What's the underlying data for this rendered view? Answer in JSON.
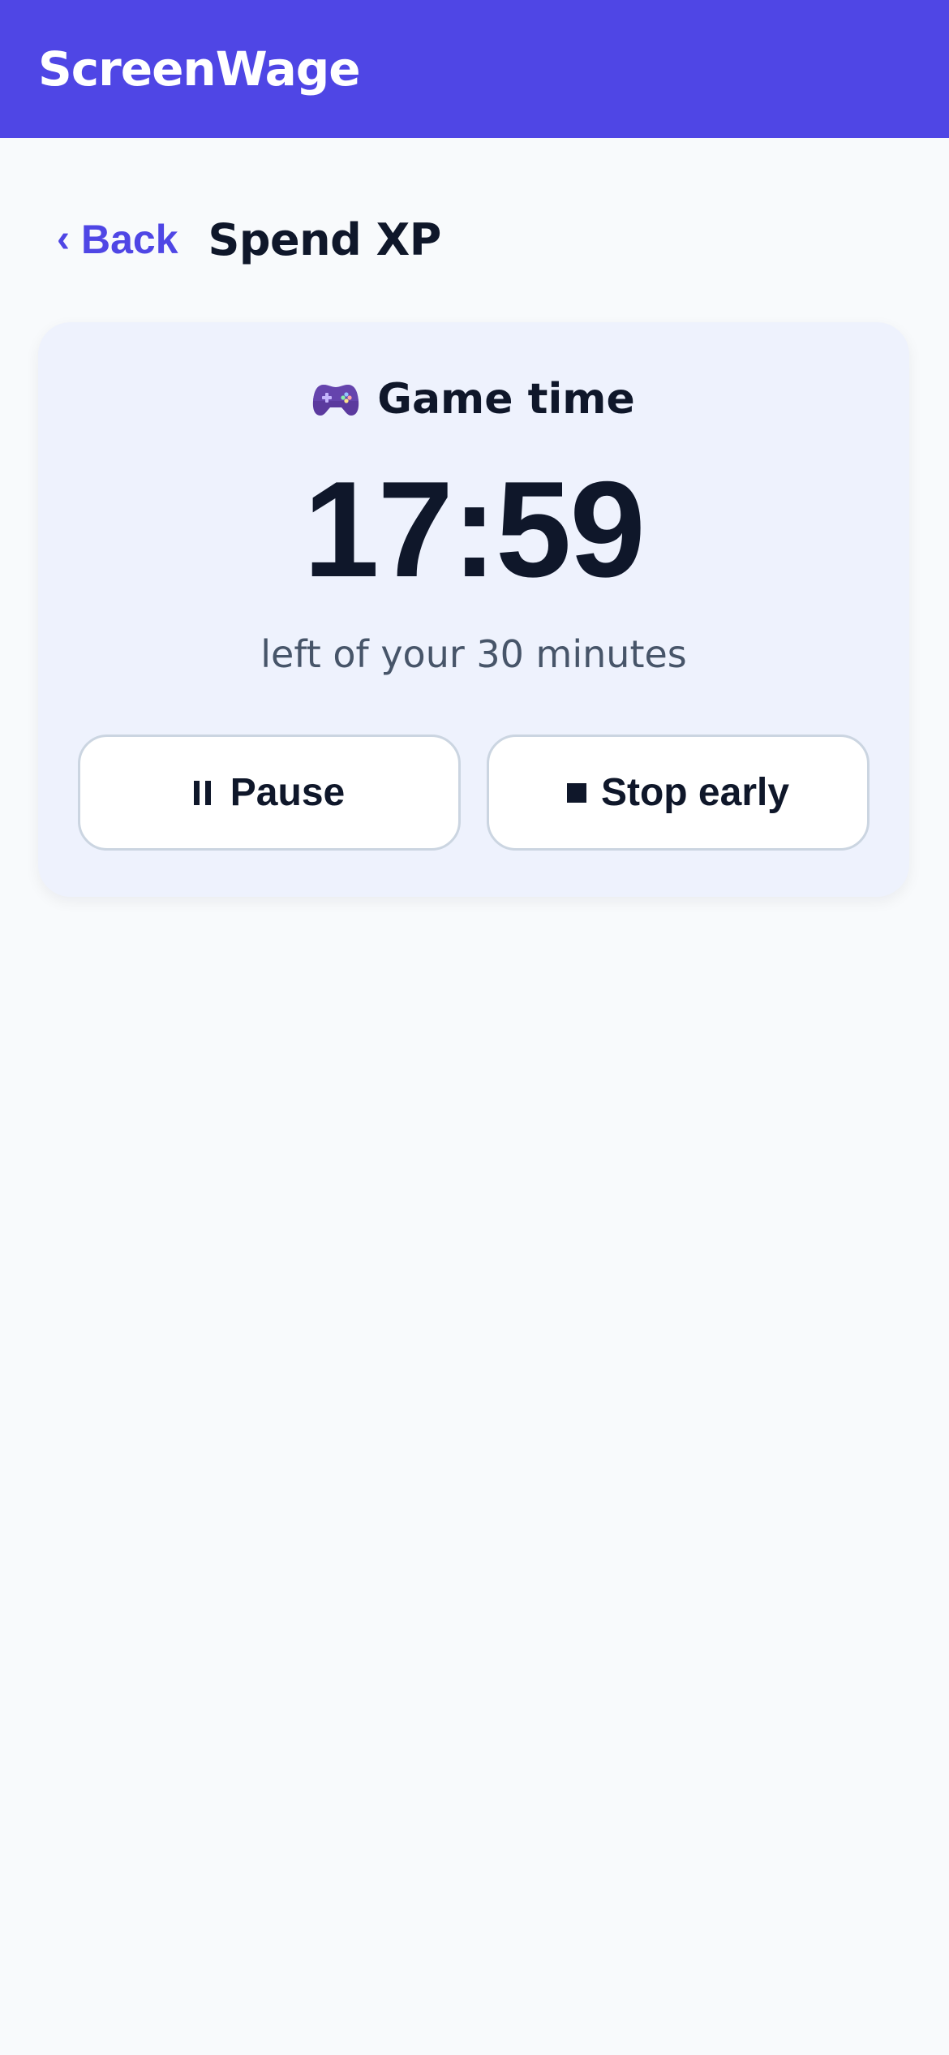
{
  "app": {
    "title": "ScreenWage"
  },
  "header": {
    "back_label": "Back",
    "back_icon": "chevron-left-icon",
    "page_title": "Spend XP"
  },
  "timer": {
    "activity_icon": "gamepad-icon",
    "activity_label": "Game time",
    "time_remaining": "17:59",
    "caption": "left of your 30 minutes"
  },
  "actions": {
    "pause_label": "Pause",
    "pause_icon": "pause-icon",
    "stop_label": "Stop early",
    "stop_icon": "stop-icon"
  },
  "colors": {
    "brand": "#4f46e5",
    "background": "#f8fafc",
    "card": "#eef2fd",
    "text": "#0f172a",
    "muted_text": "#475569"
  }
}
